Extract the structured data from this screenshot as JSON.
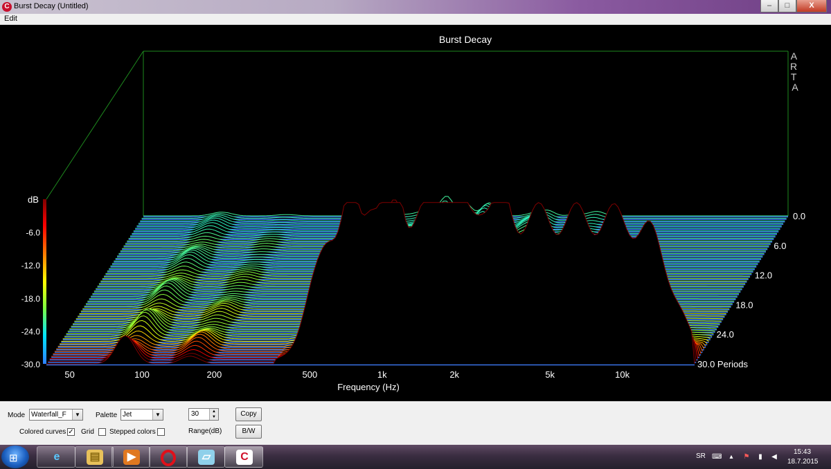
{
  "window": {
    "title": "Burst Decay  (Untitled)",
    "controls": [
      "–",
      "□",
      "X"
    ]
  },
  "menu": {
    "edit": "Edit"
  },
  "chart_data": {
    "type": "waterfall",
    "title": "Burst Decay",
    "brand": "ARTA",
    "xlabel": "Frequency (Hz)",
    "x_scale": "log",
    "xlim": [
      40,
      20000
    ],
    "x_ticks": [
      {
        "value": 50,
        "label": "50"
      },
      {
        "value": 100,
        "label": "100"
      },
      {
        "value": 200,
        "label": "200"
      },
      {
        "value": 500,
        "label": "500"
      },
      {
        "value": 1000,
        "label": "1k"
      },
      {
        "value": 2000,
        "label": "2k"
      },
      {
        "value": 5000,
        "label": "5k"
      },
      {
        "value": 10000,
        "label": "10k"
      }
    ],
    "zlabel": "dB",
    "zlim": [
      -30,
      0
    ],
    "z_ticks": [
      "-6.0",
      "-12.0",
      "-18.0",
      "-24.0",
      "-30.0"
    ],
    "y_ticks": [
      "0.0",
      "6.0",
      "12.0",
      "18.0",
      "24.0",
      "30.0 Periods"
    ],
    "ylim": [
      0,
      30
    ],
    "palette": "Jet",
    "colorbar_colors": [
      "#2e7fff",
      "#00e5ff",
      "#7fff3f",
      "#ffff00",
      "#ff7a00",
      "#ff0000",
      "#800000"
    ],
    "floor_color": "#3a73e8"
  },
  "controls": {
    "mode_label": "Mode",
    "mode_value": "Waterfall_F",
    "palette_label": "Palette",
    "palette_value": "Jet",
    "range_value": "30",
    "range_label": "Range(dB)",
    "copy_label": "Copy",
    "bw_label": "B/W",
    "colored_curves_label": "Colored curves",
    "grid_label": "Grid",
    "stepped_colors_label": "Stepped colors",
    "check_mark": "✓"
  },
  "taskbar": {
    "language": "SR",
    "time": "15:43",
    "date": "18.7.2015"
  }
}
